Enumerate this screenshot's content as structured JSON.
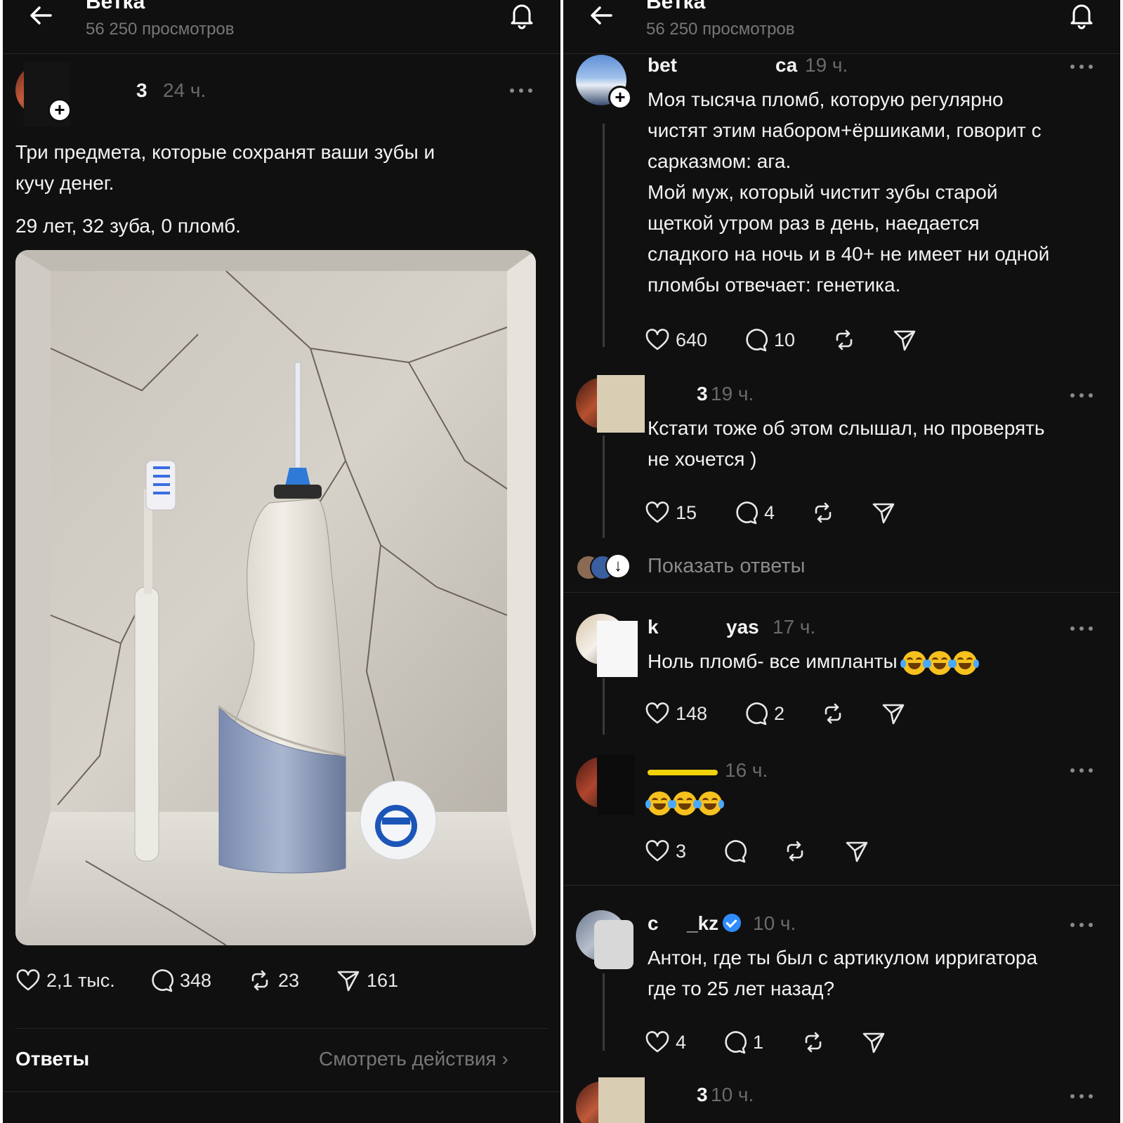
{
  "header": {
    "title": "Ветка",
    "views": "56 250 просмотров"
  },
  "post": {
    "username_visible": "3",
    "time": "24 ч.",
    "text_line1": "Три предмета, которые сохранят ваши зубы и",
    "text_line2": "кучу денег.",
    "text_stats": "29 лет, 32 зуба, 0 пломб.",
    "likes": "2,1 тыс.",
    "comments": "348",
    "reposts": "23",
    "shares": "161",
    "replies_label": "Ответы",
    "view_actions": "Смотреть действия ›"
  },
  "comments": [
    {
      "username_start": "bet",
      "username_end": "ca",
      "time": "19 ч.",
      "lines": [
        "Моя тысяча пломб, которую регулярно",
        "чистят этим набором+ёршиками, говорит с",
        "сарказмом: ага.",
        "Мой муж, который чистит зубы старой",
        "щеткой утром раз в день, наедается",
        "сладкого на ночь и в 40+ не имеет ни одной",
        "пломбы отвечает: генетика."
      ],
      "likes": "640",
      "comments": "10"
    },
    {
      "username_end": "3",
      "time": "19 ч.",
      "lines": [
        "Кстати тоже об этом слышал, но проверять",
        "не хочется )"
      ],
      "likes": "15",
      "comments": "4",
      "show_replies": "Показать ответы"
    },
    {
      "username_start": "k",
      "username_end": "yas",
      "time": "17 ч.",
      "text": "Ноль пломб- все импланты",
      "likes": "148",
      "comments": "2"
    },
    {
      "time": "16 ч.",
      "likes": "3"
    },
    {
      "username_start": "c",
      "username_end": "_kz",
      "time": "10 ч.",
      "lines": [
        "Антон, где ты был с артикулом ирригатора",
        "где то 25 лет назад?"
      ],
      "likes": "4",
      "comments": "1"
    },
    {
      "username_end": "3",
      "time": "10 ч."
    }
  ],
  "colors": {
    "background": "#101010",
    "text": "#f3f3f3",
    "muted": "#777777",
    "verified": "#2f8cff",
    "emoji": "#f7c21f"
  },
  "icons": [
    "back-arrow-icon",
    "bell-icon",
    "heart-icon",
    "comment-icon",
    "repost-icon",
    "share-icon",
    "more-icon",
    "verified-icon",
    "arrow-down-icon",
    "plus-icon"
  ]
}
